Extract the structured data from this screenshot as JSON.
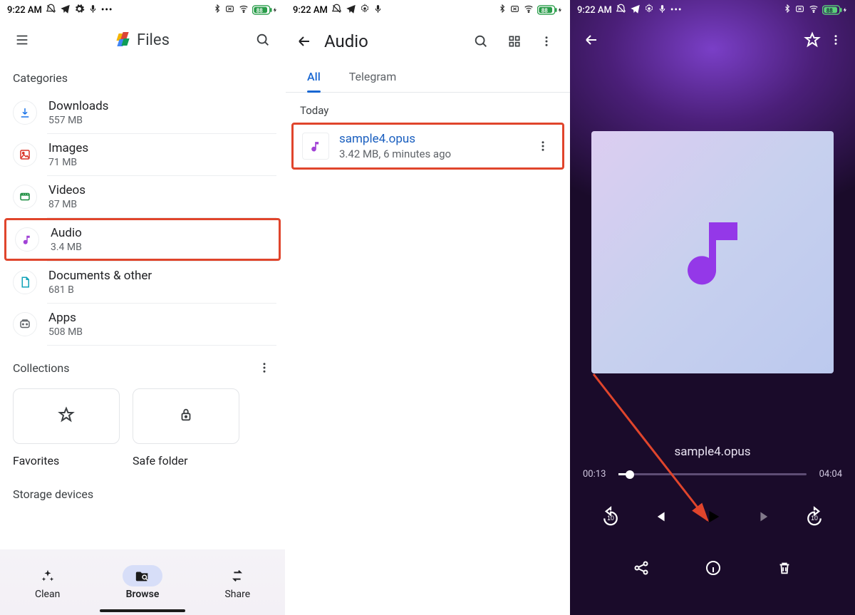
{
  "statusbar": {
    "time": "9:22 AM",
    "battery": "88"
  },
  "screen1": {
    "appTitle": "Files",
    "categoriesLabel": "Categories",
    "categories": [
      {
        "name": "Downloads",
        "sub": "557 MB"
      },
      {
        "name": "Images",
        "sub": "71 MB"
      },
      {
        "name": "Videos",
        "sub": "87 MB"
      },
      {
        "name": "Audio",
        "sub": "3.4 MB"
      },
      {
        "name": "Documents & other",
        "sub": "681 B"
      },
      {
        "name": "Apps",
        "sub": "508 MB"
      }
    ],
    "collectionsLabel": "Collections",
    "favoritesLabel": "Favorites",
    "safeFolderLabel": "Safe folder",
    "storageDevicesLabel": "Storage devices",
    "nav": {
      "clean": "Clean",
      "browse": "Browse",
      "share": "Share"
    }
  },
  "screen2": {
    "title": "Audio",
    "tabs": {
      "all": "All",
      "telegram": "Telegram"
    },
    "groupLabel": "Today",
    "file": {
      "name": "sample4.opus",
      "sub": "3.42 MB, 6 minutes ago"
    }
  },
  "screen3": {
    "trackTitle": "sample4.opus",
    "elapsed": "00:13",
    "duration": "04:04"
  }
}
